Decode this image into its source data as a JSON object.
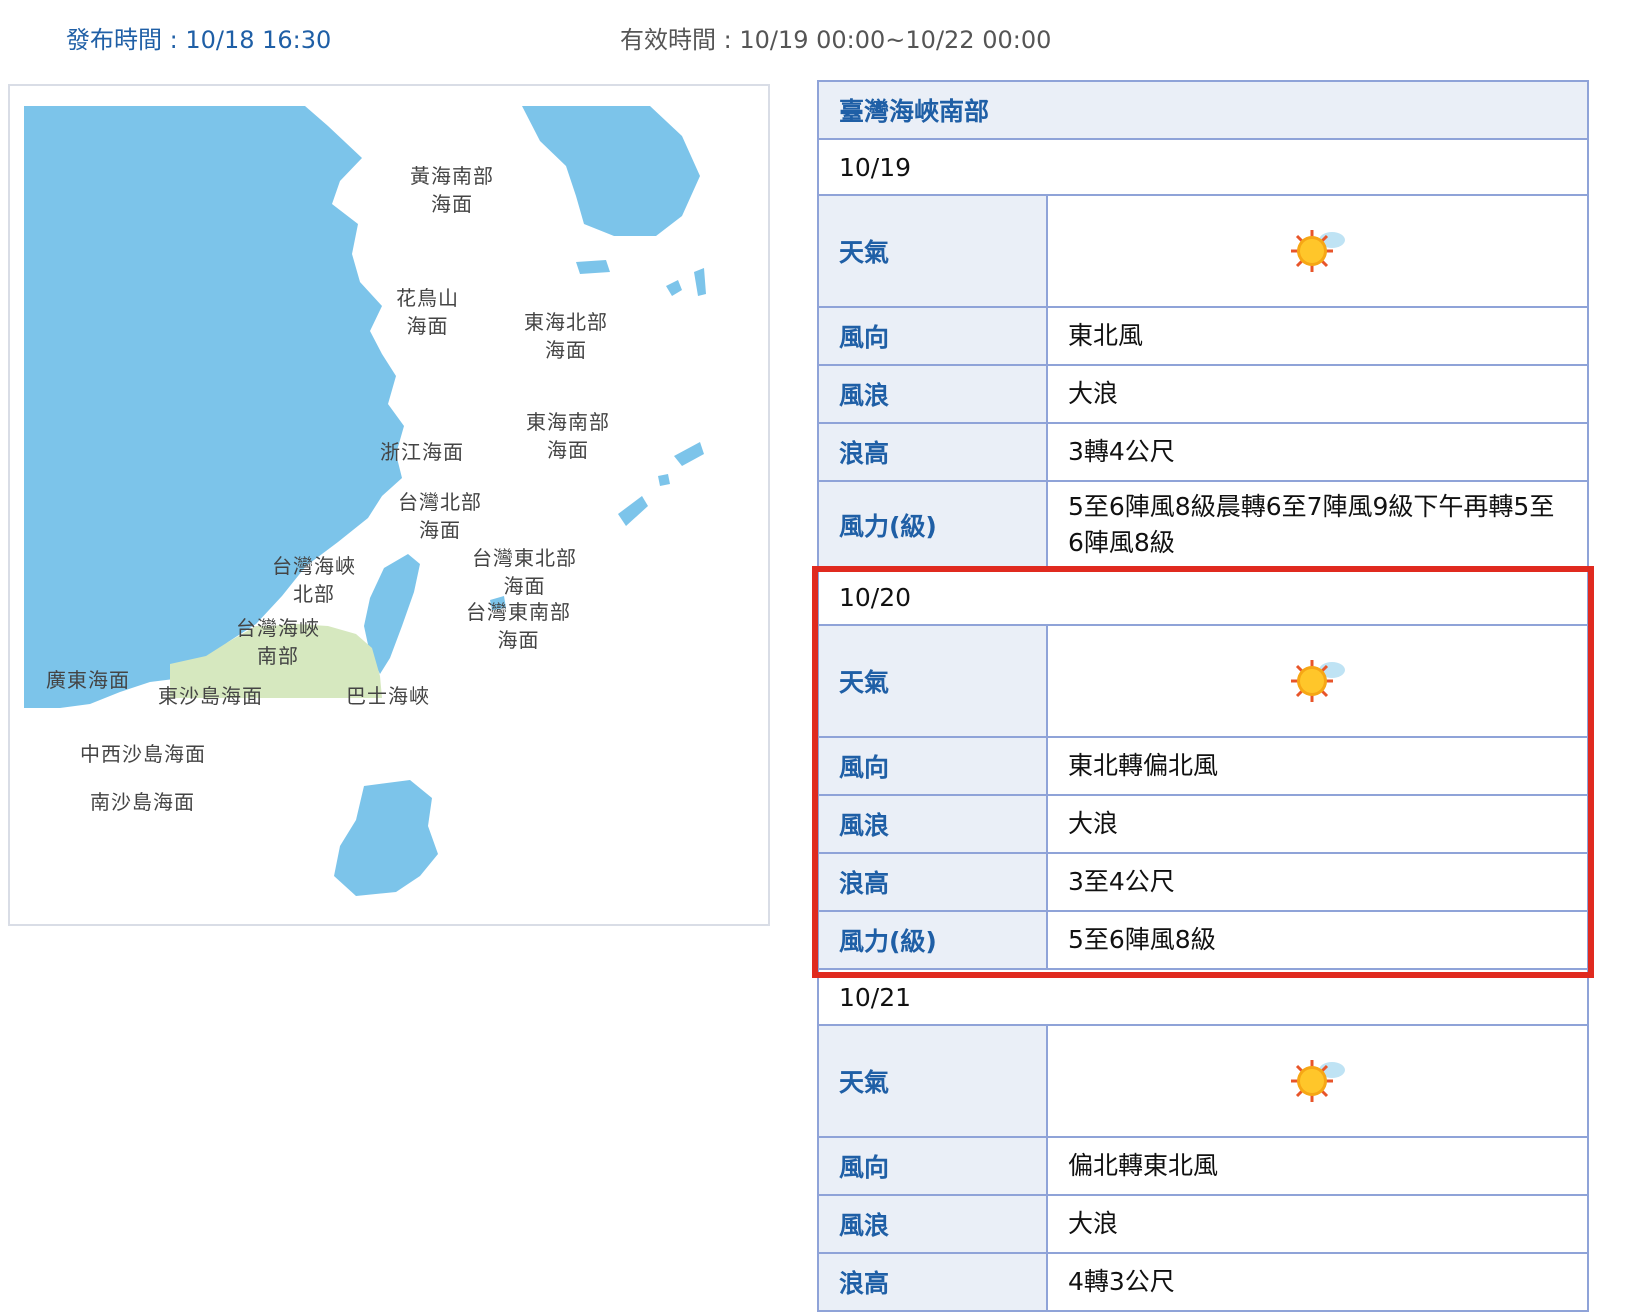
{
  "header": {
    "issue_time": "發布時間 : 10/18 16:30",
    "valid_time": "有效時間 : 10/19 00:00~10/22 00:00"
  },
  "map": {
    "labels": {
      "yellow_sea_south": "黃海南部\n海面",
      "huaniaoshan": "花鳥山\n海面",
      "east_china_sea_north": "東海北部\n海面",
      "east_china_sea_south": "東海南部\n海面",
      "zhejiang": "浙江海面",
      "taiwan_north": "台灣北部\n海面",
      "taiwan_strait_north": "台灣海峽\n北部",
      "taiwan_northeast": "台灣東北部\n海面",
      "taiwan_southeast": "台灣東南部\n海面",
      "taiwan_strait_south": "台灣海峽\n南部",
      "guangdong": "廣東海面",
      "dongsha": "東沙島海面",
      "bashi": "巴士海峽",
      "zhongxisha": "中西沙島海面",
      "nansha": "南沙島海面"
    },
    "colors": {
      "sea_land": "#7cc4ea",
      "selected_area": "#d6e8bf"
    }
  },
  "forecast": {
    "region": "臺灣海峽南部",
    "labels": {
      "weather": "天氣",
      "wind_dir": "風向",
      "wave": "風浪",
      "wave_height": "浪高",
      "wind_force": "風力(級)"
    },
    "days": [
      {
        "date": "10/19",
        "weather_icon": "sunny-cloud-icon",
        "wind_dir": "東北風",
        "wave": "大浪",
        "wave_height": "3轉4公尺",
        "wind_force": "5至6陣風8級晨轉6至7陣風9級下午再轉5至6陣風8級"
      },
      {
        "date": "10/20",
        "weather_icon": "sunny-cloud-icon",
        "wind_dir": "東北轉偏北風",
        "wave": "大浪",
        "wave_height": "3至4公尺",
        "wind_force": "5至6陣風8級"
      },
      {
        "date": "10/21",
        "weather_icon": "sunny-cloud-icon",
        "wind_dir": "偏北轉東北風",
        "wave": "大浪",
        "wave_height": "4轉3公尺"
      }
    ]
  },
  "colors": {
    "accent_blue": "#1f5fa6",
    "table_border": "#8fa3d8",
    "label_bg": "#eaeff7",
    "highlight_red": "#e02a1f"
  }
}
